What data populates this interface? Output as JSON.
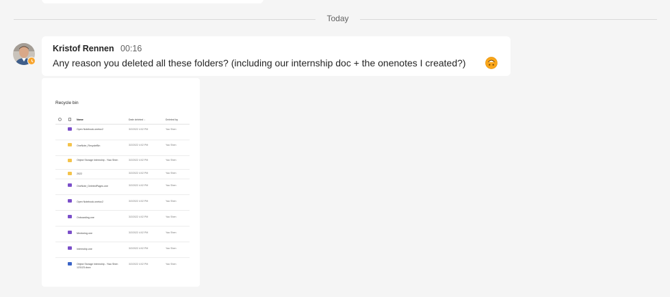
{
  "divider": {
    "label": "Today"
  },
  "message": {
    "author": "Kristof Rennen",
    "time": "00:16",
    "text": "Any reason you deleted all these folders? (including our internship doc + the onenotes I created?)",
    "emoji": "upside-down-smile-emoji"
  },
  "attachment": {
    "title": "Recycle bin",
    "columns": {
      "name": "Name",
      "date": "Date deleted ↓",
      "by": "Deleted by"
    },
    "rows": [
      {
        "icon": "onenote-icon",
        "name": "Open Notebook.onetoc2",
        "date": "3/2/2022 4:02 PM",
        "by": "Yao Shen"
      },
      {
        "icon": "folder-icon",
        "name": "OneNote_RecycleBin",
        "date": "3/2/2022 4:02 PM",
        "by": "Yao Shen"
      },
      {
        "icon": "folder-icon",
        "name": "Object Storage Internship - Yiao Shen",
        "date": "3/2/2022 4:02 PM",
        "by": "Yao Shen"
      },
      {
        "icon": "folder-icon",
        "name": "2022",
        "date": "3/2/2022 4:02 PM",
        "by": "Yao Shen"
      },
      {
        "icon": "onenote-icon",
        "name": "OneNote_DeletedPages.one",
        "date": "3/2/2022 4:02 PM",
        "by": "Yao Shen"
      },
      {
        "icon": "onenote-icon",
        "name": "Open Notebook.onetoc2",
        "date": "3/2/2022 4:02 PM",
        "by": "Yao Shen"
      },
      {
        "icon": "onenote-icon",
        "name": "Onboarding.one",
        "date": "3/2/2022 4:02 PM",
        "by": "Yao Shen"
      },
      {
        "icon": "onenote-icon",
        "name": "Mentoring.one",
        "date": "3/2/2022 4:02 PM",
        "by": "Yao Shen"
      },
      {
        "icon": "onenote-icon",
        "name": "Internship.one",
        "date": "3/2/2022 4:02 PM",
        "by": "Yao Shen"
      },
      {
        "icon": "word-icon",
        "name": "Object Storage Internship - Yiao Shen 123123.docx",
        "date": "3/2/2022 4:02 PM",
        "by": "Yao Shen"
      }
    ]
  },
  "colors": {
    "presence_away": "#f8a42c",
    "card_bg": "#ffffff",
    "page_bg": "#f5f5f5"
  }
}
